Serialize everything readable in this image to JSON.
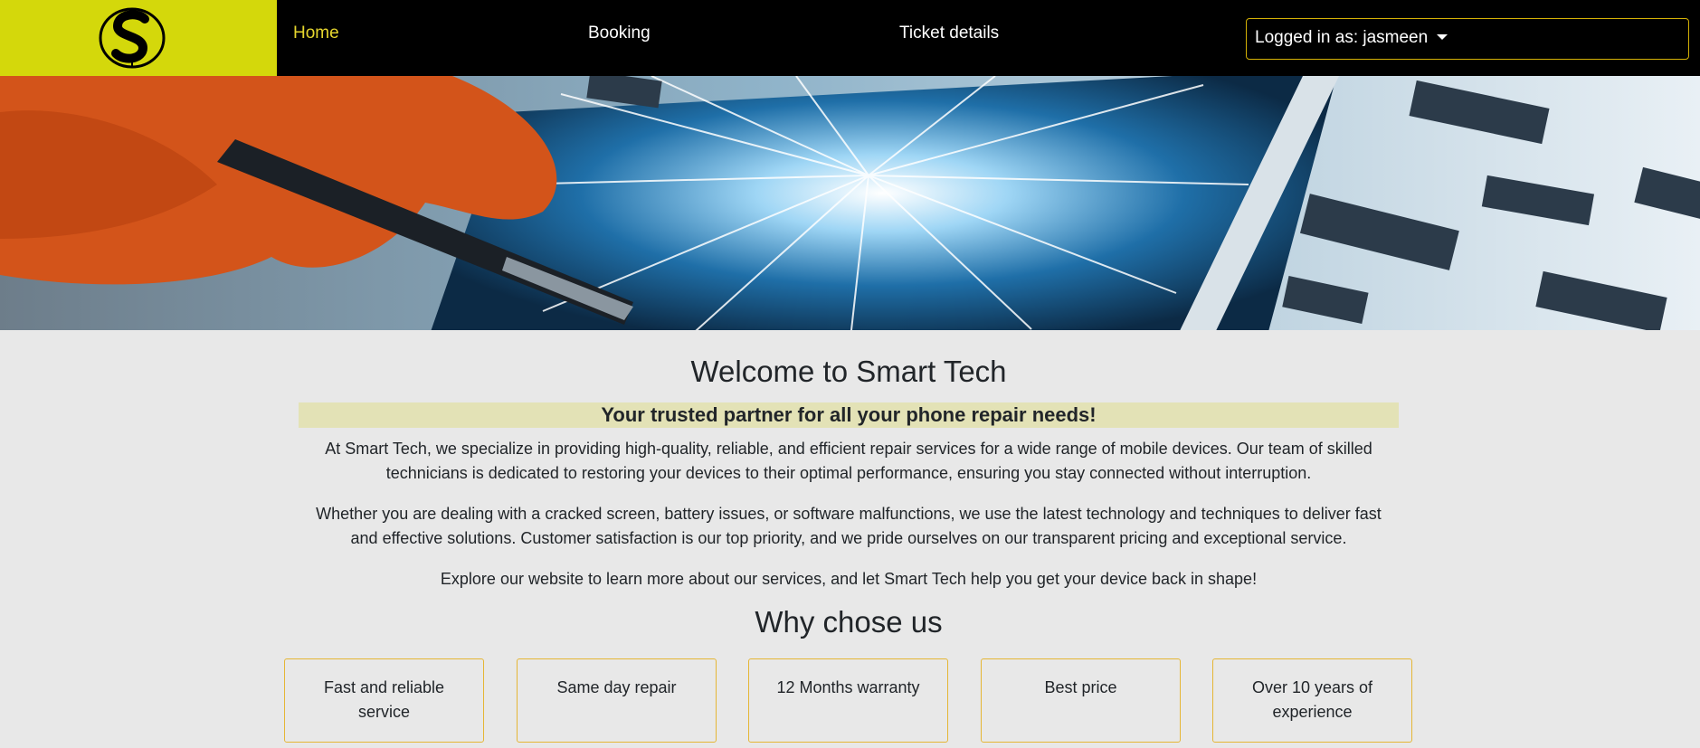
{
  "nav": {
    "logo_icon": "smart-tech-s-logo",
    "links": [
      {
        "label": "Home",
        "active": true
      },
      {
        "label": "Booking",
        "active": false
      },
      {
        "label": "Ticket details",
        "active": false
      }
    ],
    "user_dropdown_label": "Logged in as: jasmeen"
  },
  "hero": {
    "image": "broken-phone-repair-banner"
  },
  "main": {
    "title": "Welcome to Smart Tech",
    "tagline": "Your trusted partner for all your phone repair needs!",
    "paragraphs": [
      "At Smart Tech, we specialize in providing high-quality, reliable, and efficient repair services for a wide range of mobile devices. Our team of skilled technicians is dedicated to restoring your devices to their optimal performance, ensuring you stay connected without interruption.",
      "Whether you are dealing with a cracked screen, battery issues, or software malfunctions, we use the latest technology and techniques to deliver fast and effective solutions. Customer satisfaction is our top priority, and we pride ourselves on our transparent pricing and exceptional service.",
      "Explore our website to learn more about our services, and let Smart Tech help you get your device back in shape!"
    ],
    "why_title": "Why chose us",
    "features": [
      "Fast and reliable service",
      "Same day repair",
      "12 Months warranty",
      "Best price",
      "Over 10 years of experience"
    ]
  },
  "colors": {
    "nav_bg": "#000000",
    "logo_bg": "#d4d80b",
    "active_link": "#e6d62e",
    "accent_border": "#e5b635",
    "tagline_bg": "#e3e2b6",
    "page_bg": "#e8e8e8"
  }
}
